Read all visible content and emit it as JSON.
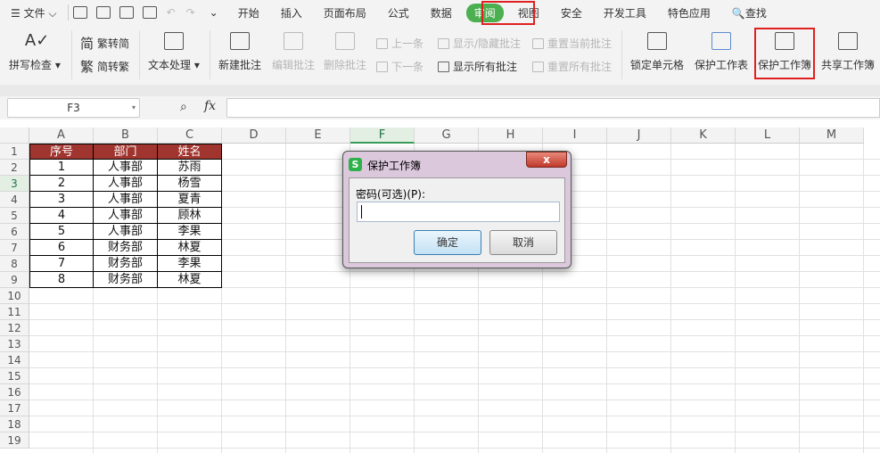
{
  "menubar": {
    "file": "文件",
    "tabs": [
      "开始",
      "插入",
      "页面布局",
      "公式",
      "数据",
      "审阅",
      "视图",
      "安全",
      "开发工具",
      "特色应用"
    ],
    "active_tab": "审阅",
    "search": "查找"
  },
  "ribbon": {
    "spell_check": "拼写检查",
    "trad_to_simp": "繁转简",
    "simp_to_trad": "简转繁",
    "text_processing": "文本处理",
    "new_comment": "新建批注",
    "edit_comment": "编辑批注",
    "delete_comment": "删除批注",
    "prev": "上一条",
    "next": "下一条",
    "show_hide_comment": "显示/隐藏批注",
    "show_all_comments": "显示所有批注",
    "reset_current_comment": "重置当前批注",
    "reset_all_comments": "重置所有批注",
    "lock_cells": "锁定单元格",
    "protect_sheet": "保护工作表",
    "protect_workbook": "保护工作簿",
    "share_workbook": "共享工作簿"
  },
  "formula_bar": {
    "cell_ref": "F3",
    "fx": "fx",
    "value": ""
  },
  "columns": [
    "A",
    "B",
    "C",
    "D",
    "E",
    "F",
    "G",
    "H",
    "I",
    "J",
    "K",
    "L",
    "M"
  ],
  "rows": [
    "1",
    "2",
    "3",
    "4",
    "5",
    "6",
    "7",
    "8",
    "9",
    "10",
    "11",
    "12",
    "13",
    "14",
    "15",
    "16",
    "17",
    "18",
    "19"
  ],
  "table": {
    "headers": [
      "序号",
      "部门",
      "姓名"
    ],
    "data": [
      [
        "1",
        "人事部",
        "苏雨"
      ],
      [
        "2",
        "人事部",
        "杨雪"
      ],
      [
        "3",
        "人事部",
        "夏青"
      ],
      [
        "4",
        "人事部",
        "顾林"
      ],
      [
        "5",
        "人事部",
        "李果"
      ],
      [
        "6",
        "财务部",
        "林夏"
      ],
      [
        "7",
        "财务部",
        "李果"
      ],
      [
        "8",
        "财务部",
        "林夏"
      ]
    ]
  },
  "dialog": {
    "title": "保护工作簿",
    "close": "x",
    "label": "密码(可选)(P):",
    "password": "",
    "ok": "确定",
    "cancel": "取消"
  }
}
